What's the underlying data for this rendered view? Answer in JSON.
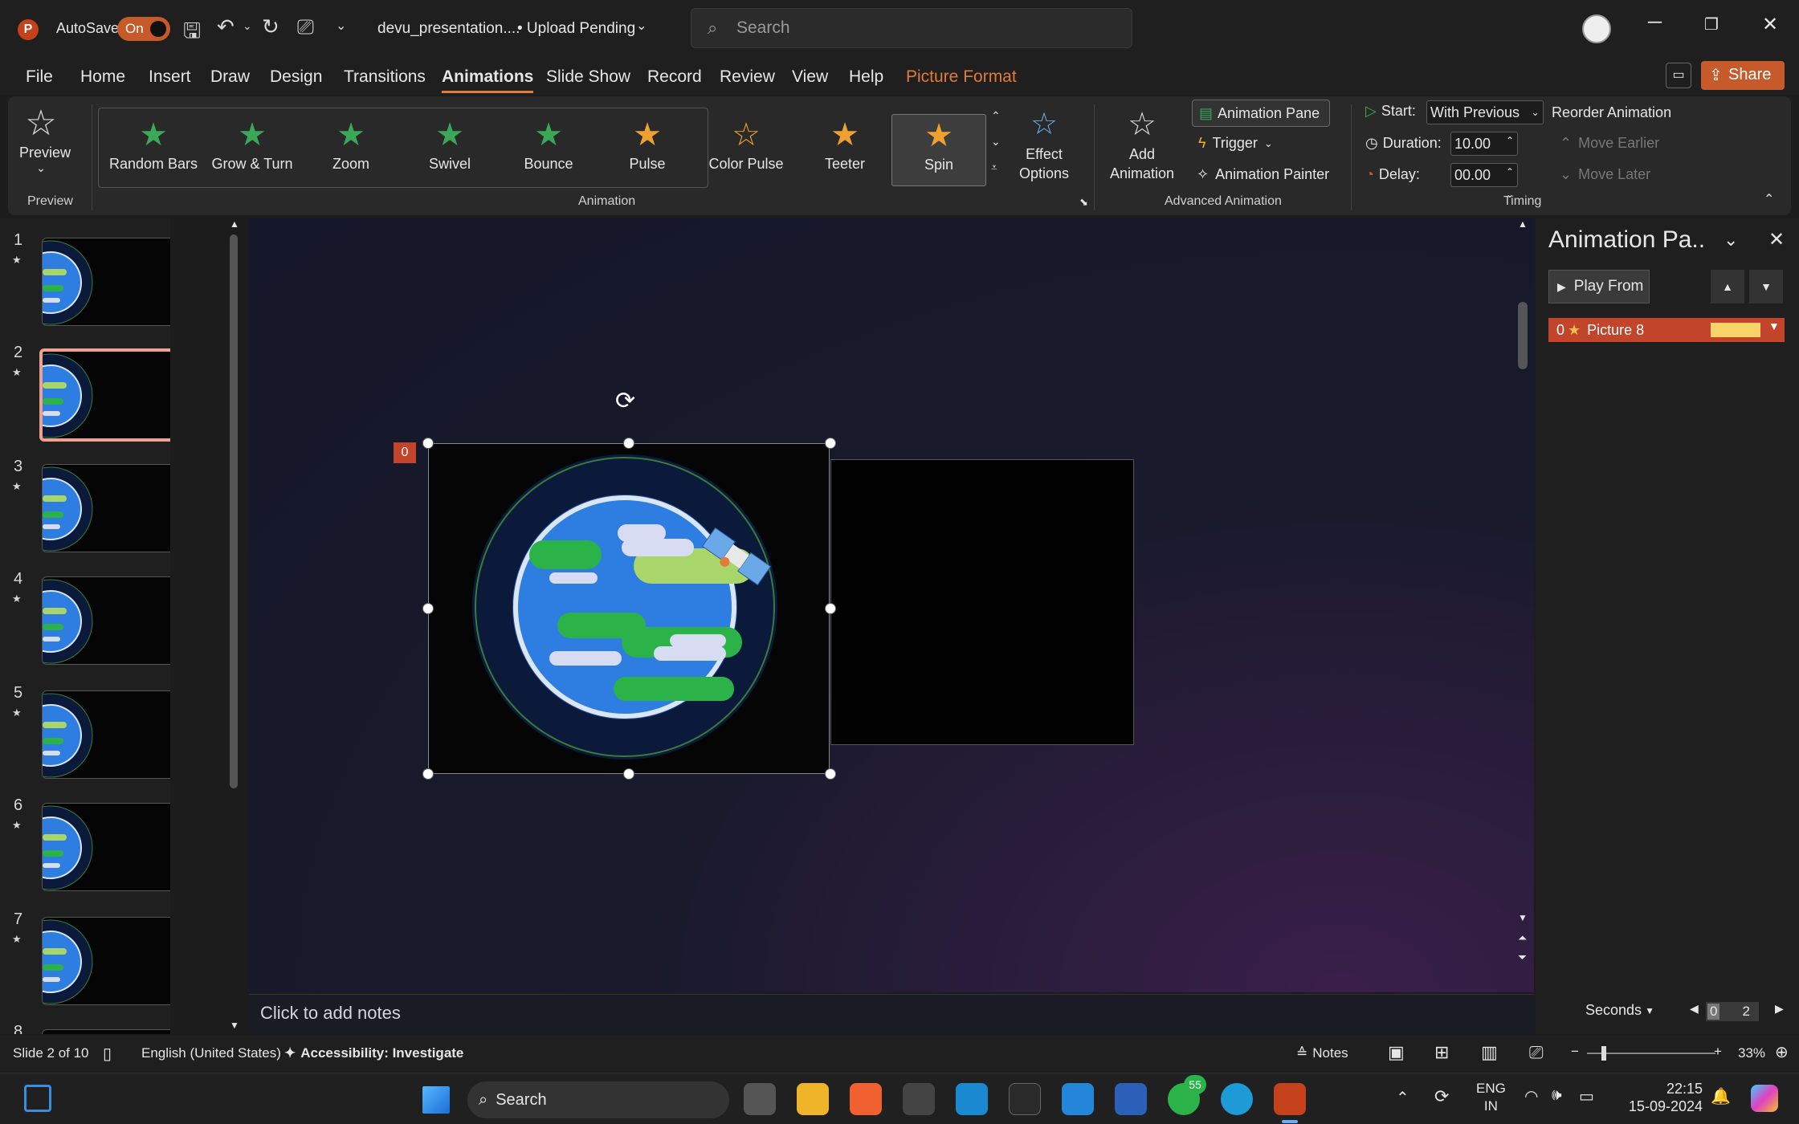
{
  "titlebar": {
    "autosave_label": "AutoSave",
    "autosave_state": "On",
    "filename": "devu_presentation....",
    "upload_status": "• Upload Pending",
    "search_placeholder": "Search"
  },
  "menu": {
    "items": [
      "File",
      "Home",
      "Insert",
      "Draw",
      "Design",
      "Transitions",
      "Animations",
      "Slide Show",
      "Record",
      "Review",
      "View",
      "Help",
      "Picture Format"
    ],
    "active": "Animations",
    "share_label": "Share"
  },
  "ribbon": {
    "preview_label": "Preview",
    "preview_group": "Preview",
    "animation_group": "Animation",
    "animations": [
      "Random Bars",
      "Grow & Turn",
      "Zoom",
      "Swivel",
      "Bounce",
      "Pulse",
      "Color Pulse",
      "Teeter",
      "Spin"
    ],
    "selected_animation": "Spin",
    "effect_options": "Effect Options",
    "add_animation": "Add Animation",
    "animation_pane": "Animation Pane",
    "trigger": "Trigger",
    "animation_painter": "Animation Painter",
    "advanced_group": "Advanced Animation",
    "start_label": "Start:",
    "start_value": "With Previous",
    "duration_label": "Duration:",
    "duration_value": "10.00",
    "delay_label": "Delay:",
    "delay_value": "00.00",
    "timing_group": "Timing",
    "reorder_label": "Reorder Animation",
    "move_earlier": "Move Earlier",
    "move_later": "Move Later"
  },
  "thumbnails": [
    {
      "num": "1",
      "star": "★"
    },
    {
      "num": "2",
      "star": "★"
    },
    {
      "num": "3",
      "star": "★"
    },
    {
      "num": "4",
      "star": "★"
    },
    {
      "num": "5",
      "star": "★"
    },
    {
      "num": "6",
      "star": "★"
    },
    {
      "num": "7",
      "star": "★"
    },
    {
      "num": "8"
    }
  ],
  "slide": {
    "anim_tag": "0",
    "notes_placeholder": "Click to add notes"
  },
  "pane": {
    "title": "Animation Pa..",
    "play_from": "Play From",
    "item_index": "0",
    "item_name": "Picture 8",
    "seconds_label": "Seconds",
    "timeline_start": "0",
    "timeline_mid": "2"
  },
  "status": {
    "slide_info": "Slide 2 of 10",
    "language": "English (United States)",
    "accessibility": "Accessibility: Investigate",
    "notes": "Notes",
    "zoom": "33%"
  },
  "taskbar": {
    "search": "Search",
    "whatsapp_badge": "55",
    "lang1": "ENG",
    "lang2": "IN",
    "time": "22:15",
    "date": "15-09-2024"
  },
  "colors": {
    "accent": "#e07b39",
    "anim_item": "#c2452b",
    "earth_blue": "#2e7de0",
    "earth_green": "#2bb34a"
  }
}
